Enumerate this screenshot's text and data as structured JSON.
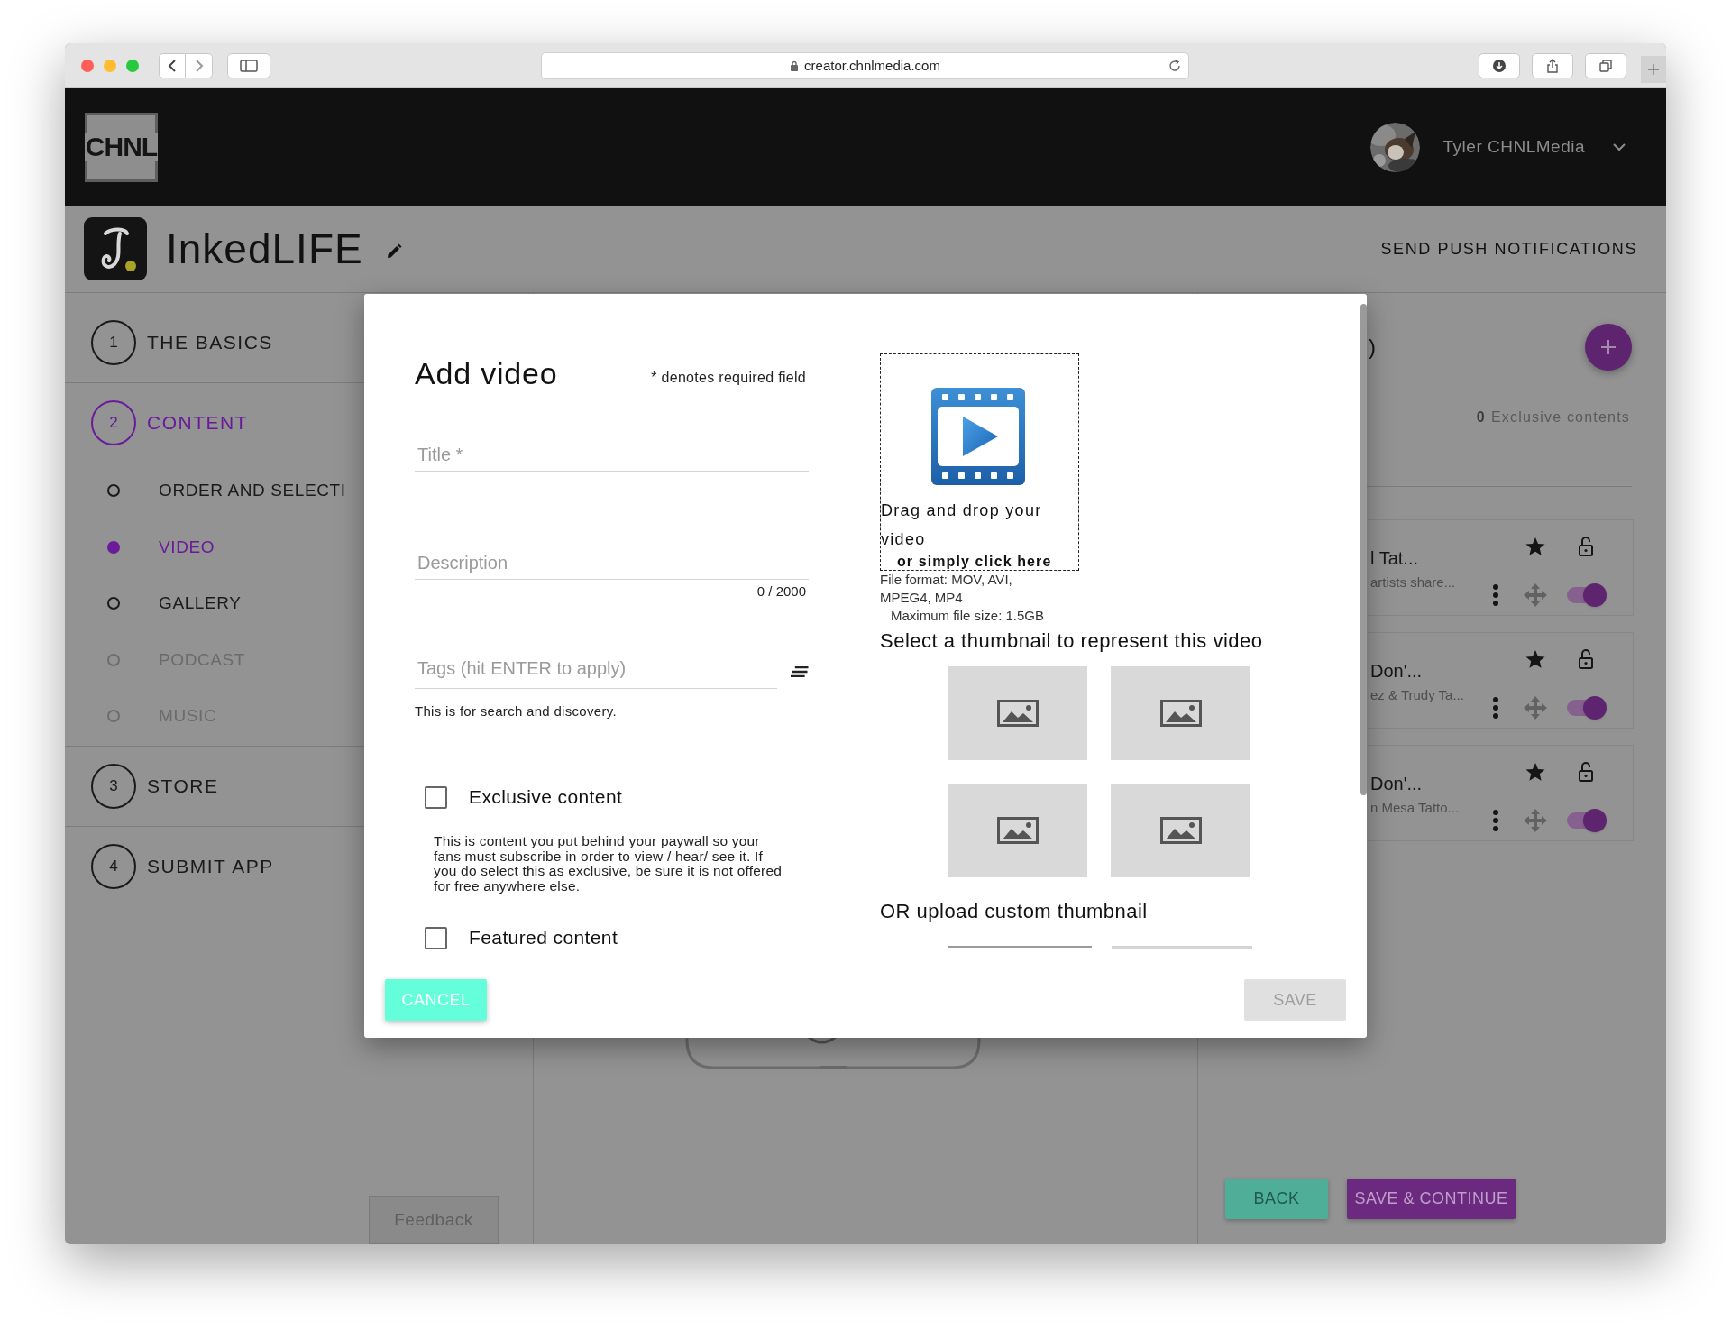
{
  "browser": {
    "url": "creator.chnlmedia.com"
  },
  "header": {
    "logo": "CHNL",
    "user_name": "Tyler CHNLMedia"
  },
  "app_bar": {
    "app_name": "InkedLIFE",
    "action": "SEND PUSH NOTIFICATIONS"
  },
  "sidebar": {
    "steps": [
      {
        "number": "1",
        "label": "THE BASICS",
        "selected": false
      },
      {
        "number": "2",
        "label": "CONTENT",
        "selected": true,
        "children": [
          {
            "label": "ORDER AND SELECTI",
            "selected": false,
            "disabled": false
          },
          {
            "label": "VIDEO",
            "selected": true,
            "disabled": false
          },
          {
            "label": "GALLERY",
            "selected": false,
            "disabled": false
          },
          {
            "label": "PODCAST",
            "selected": false,
            "disabled": true
          },
          {
            "label": "MUSIC",
            "selected": false,
            "disabled": true
          }
        ]
      },
      {
        "number": "3",
        "label": "STORE",
        "selected": false
      },
      {
        "number": "4",
        "label": "SUBMIT APP",
        "selected": false
      }
    ],
    "feedback": "Feedback"
  },
  "content_panel": {
    "heading_fragment": ")",
    "exclusive_count": "0",
    "exclusive_label": "Exclusive contents",
    "items": [
      {
        "title": "l Tat...",
        "subtitle": "artists share...",
        "featured": true,
        "locked": false,
        "enabled": true
      },
      {
        "title": "Don'...",
        "subtitle": "ez & Trudy Ta...",
        "featured": true,
        "locked": false,
        "enabled": true
      },
      {
        "title": "Don'...",
        "subtitle": "n Mesa Tatto...",
        "featured": true,
        "locked": false,
        "enabled": true
      }
    ],
    "buttons": [
      {
        "label": "BACK",
        "kind": "back"
      },
      {
        "label": "SAVE & CONTINUE",
        "kind": "save"
      }
    ]
  },
  "modal": {
    "title": "Add video",
    "required_note": "* denotes required field",
    "fields": [
      {
        "placeholder": "Title *"
      },
      {
        "placeholder": "Description",
        "counter": "0 / 2000"
      },
      {
        "placeholder": "Tags (hit ENTER to apply)",
        "hint": "This is for search and discovery."
      }
    ],
    "options": [
      {
        "label": "Exclusive content",
        "checked": false,
        "description": "This is content you put behind your paywall so your fans must subscribe in order to view / hear/ see it. If you do select this as exclusive, be sure it is not offered for free anywhere else."
      },
      {
        "label": "Featured content",
        "checked": false
      }
    ],
    "dropzone": {
      "drag_text": "Drag and drop your video",
      "click_text": "or simply click here",
      "formats": "File format: MOV, AVI, MPEG4, MP4",
      "max_size": "Maximum file size: 1.5GB"
    },
    "thumbnail_heading": "Select a thumbnail to represent this video",
    "thumbnails": [
      {
        "selected": false
      },
      {
        "selected": false
      },
      {
        "selected": false
      },
      {
        "selected": false
      }
    ],
    "custom_thumbnail_heading": "OR upload custom thumbnail",
    "buttons": [
      {
        "label": "CANCEL",
        "kind": "cancel",
        "disabled": false
      },
      {
        "label": "SAVE",
        "kind": "save",
        "disabled": true
      }
    ]
  }
}
